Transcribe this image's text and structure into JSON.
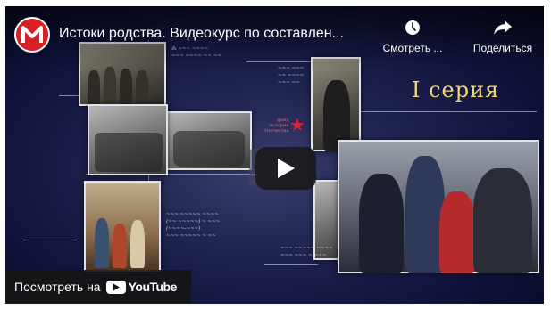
{
  "player": {
    "title": "Истоки родства. Видеокурс по составлен...",
    "watch_later_label": "Смотреть ...",
    "share_label": "Поделиться",
    "watch_on_label": "Посмотреть на",
    "youtube_wordmark": "YouTube",
    "channel_logo_letter": "М"
  },
  "video_frame": {
    "series_label": "I серия",
    "badge_text": "Истоки родства",
    "star_caption": [
      "фонд",
      "история",
      "Отечества"
    ]
  },
  "colors": {
    "channel_logo": "#d61f26",
    "youtube_red": "#ff0000",
    "series_gold": "#f2d67a",
    "background_navy": "#10133a"
  },
  "icons": {
    "watch_later": "clock-icon",
    "share": "share-arrow-icon",
    "play": "play-icon"
  }
}
